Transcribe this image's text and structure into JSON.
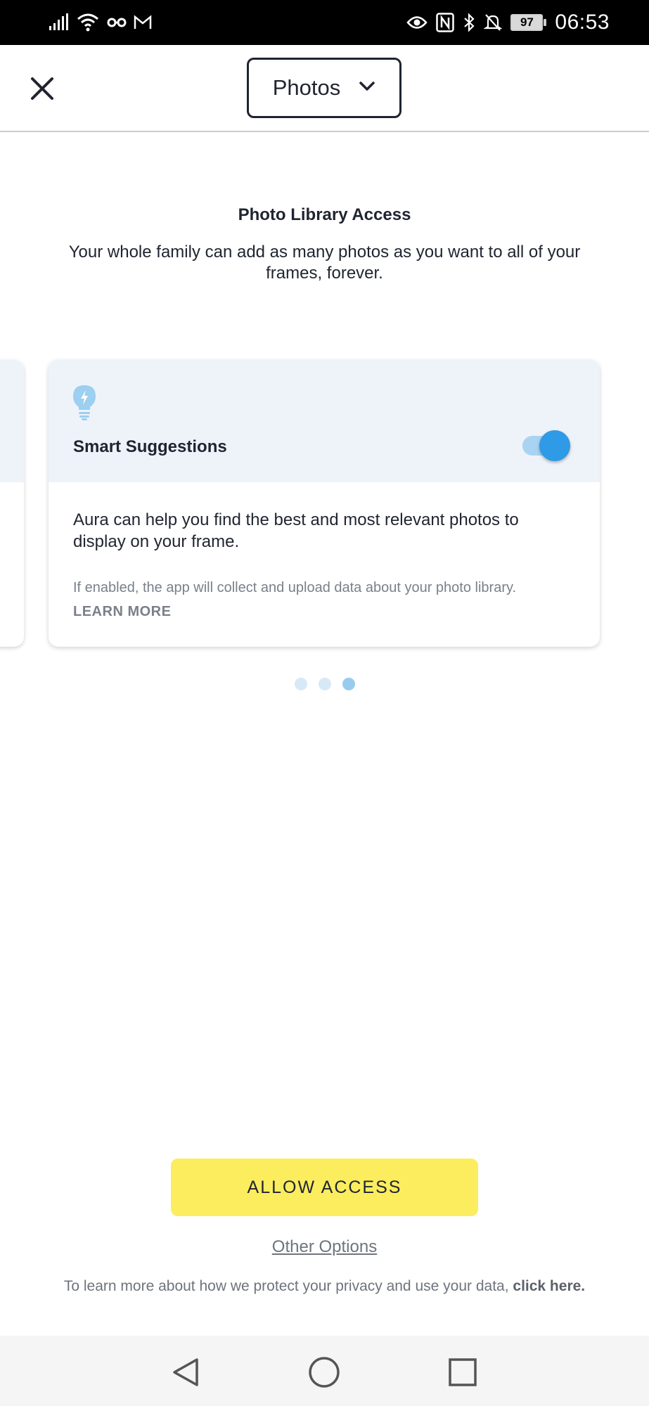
{
  "status_bar": {
    "time": "06:53",
    "battery": "97",
    "icons_left": [
      "signal-icon",
      "wifi-icon",
      "incognito-icon",
      "gmail-icon"
    ],
    "icons_right": [
      "eye-icon",
      "nfc-icon",
      "bluetooth-icon",
      "mute-bell-icon",
      "battery-icon"
    ]
  },
  "header": {
    "close_icon": "close-icon",
    "source_select": {
      "label": "Photos",
      "icon": "chevron-down-icon"
    }
  },
  "intro": {
    "title": "Photo Library Access",
    "text": "Your whole family can add as many photos as you want to all of your frames, forever."
  },
  "card": {
    "icon": "lightbulb-icon",
    "title": "Smart Suggestions",
    "toggle_on": true,
    "body": "Aura can help you find the best and most relevant photos to display on your frame.",
    "note": "If enabled, the app will collect and upload data about your photo library.",
    "learn_more": "LEARN MORE"
  },
  "pager": {
    "count": 3,
    "active_index": 2
  },
  "actions": {
    "allow_label": "ALLOW ACCESS",
    "other_options_label": "Other Options",
    "privacy_text": "To learn more about how we protect your privacy and use your data,",
    "privacy_link": "click here."
  },
  "colors": {
    "accent_yellow": "#fbed5e",
    "toggle_blue": "#2f9ae6",
    "card_head_bg": "#eef3fa",
    "text_dark": "#1f2430",
    "text_muted": "#7a808a"
  },
  "nav_bar": {
    "buttons": [
      "back-icon",
      "home-icon",
      "recents-icon"
    ]
  }
}
